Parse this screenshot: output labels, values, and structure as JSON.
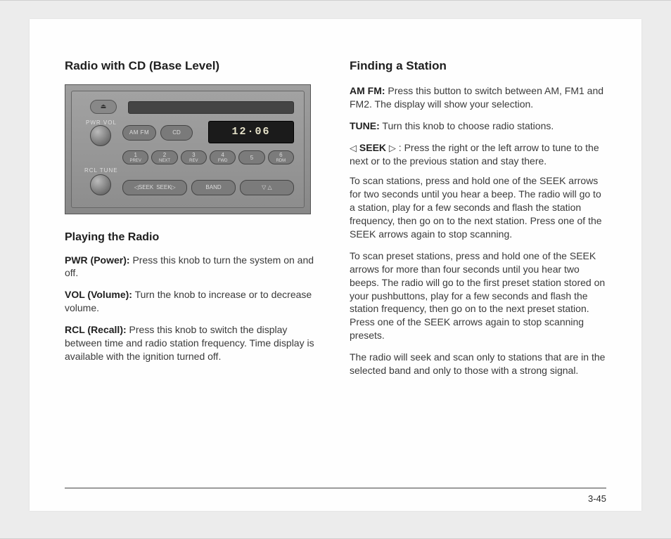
{
  "page_number": "3-45",
  "left": {
    "title": "Radio with CD (Base Level)",
    "radio": {
      "eject_icon": "⏏",
      "amfm_label": "AM FM",
      "cd_label": "CD",
      "display_time": "12·06",
      "pwr_vol_label": "PWR  VOL",
      "rcl_tune_label": "RCL  TUNE",
      "presets": [
        {
          "n": "1",
          "s": "PREV"
        },
        {
          "n": "2",
          "s": "NEXT"
        },
        {
          "n": "3",
          "s": "REV"
        },
        {
          "n": "4",
          "s": "FWD"
        },
        {
          "n": "5",
          "s": ""
        },
        {
          "n": "6",
          "s": "RDM"
        }
      ],
      "seek_left_label": "◁SEEK",
      "seek_right_label": "SEEK▷",
      "band_label": "BAND",
      "arrows_label": "▽  △"
    },
    "playing_title": "Playing the Radio",
    "pwr_label": "PWR (Power):",
    "pwr_text": " Press this knob to turn the system on and off.",
    "vol_label": "VOL (Volume):",
    "vol_text": " Turn the knob to increase or to decrease volume.",
    "rcl_label": "RCL (Recall):",
    "rcl_text": " Press this knob to switch the display between time and radio station frequency. Time display is available with the ignition turned off."
  },
  "right": {
    "title": "Finding a Station",
    "amfm_label": "AM FM:",
    "amfm_text": " Press this button to switch between AM, FM1 and FM2. The display will show your selection.",
    "tune_label": "TUNE:",
    "tune_text": " Turn this knob to choose radio stations.",
    "seek_tri_left": "◁",
    "seek_label": "SEEK",
    "seek_tri_right": "▷",
    "seek_tail": " :  Press the right or the left arrow to tune to the next or to the previous station and stay there.",
    "scan_text": "To scan stations, press and hold one of the SEEK arrows for two seconds until you hear a beep. The radio will go to a station, play for a few seconds and flash the station frequency, then go on to the next station. Press one of the SEEK arrows again to stop scanning.",
    "preset_scan_text": "To scan preset stations, press and hold one of the SEEK arrows for more than four seconds until you hear two beeps. The radio will go to the first preset station stored on your pushbuttons, play for a few seconds and flash the station frequency, then go on to the next preset station. Press one of the SEEK arrows again to stop scanning presets.",
    "signal_text": "The radio will seek and scan only to stations that are in the selected band and only to those with a strong signal."
  }
}
